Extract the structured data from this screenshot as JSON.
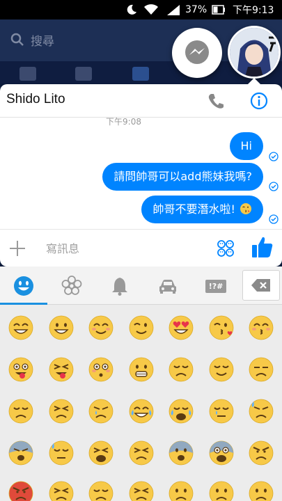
{
  "status_bar": {
    "battery": "37%",
    "time": "下午9:13"
  },
  "background_app": {
    "search_placeholder": "搜尋"
  },
  "chat": {
    "contact_name": "Shido Lito",
    "timestamp": "下午9:08",
    "messages": [
      {
        "text": "Hi",
        "from": "me",
        "status": "sent"
      },
      {
        "text": "請問帥哥可以add熊妹我嗎?",
        "from": "me",
        "status": "sent"
      },
      {
        "text": "帥哥不要潛水啦!",
        "from": "me",
        "status": "sent",
        "trailing_emoji": "kissing-wink-emoji"
      }
    ],
    "composer_placeholder": "寫訊息"
  },
  "keyboard": {
    "tabs": [
      {
        "name": "smileys",
        "icon": "smiley-icon",
        "selected": true
      },
      {
        "name": "nature",
        "icon": "flower-icon",
        "selected": false
      },
      {
        "name": "objects",
        "icon": "bell-icon",
        "selected": false
      },
      {
        "name": "places",
        "icon": "car-icon",
        "selected": false
      },
      {
        "name": "symbols",
        "label": "!?#",
        "selected": false
      }
    ],
    "emoji_rows": [
      [
        "grinning",
        "smiley",
        "blush",
        "wink",
        "heart-eyes",
        "kissing-heart",
        "kissing-closed-eyes"
      ],
      [
        "stuck-out-tongue-winking-eye",
        "stuck-out-tongue-closed-eyes",
        "flushed",
        "grimacing",
        "pensive",
        "relieved",
        "unamused"
      ],
      [
        "disappointed",
        "persevere",
        "cry",
        "joy",
        "sob",
        "sleepy",
        "disappointed-relieved"
      ],
      [
        "cold-sweat",
        "sweat",
        "weary",
        "tired",
        "fearful",
        "scream",
        "angry"
      ],
      [
        "rage",
        "confounded",
        "pensive",
        "persevere",
        "frowning",
        "frowning",
        "frowning"
      ]
    ]
  },
  "colors": {
    "messenger_blue": "#0084ff",
    "emoji_yellow": "#f7c948",
    "tab_accent": "#1a90e0"
  }
}
